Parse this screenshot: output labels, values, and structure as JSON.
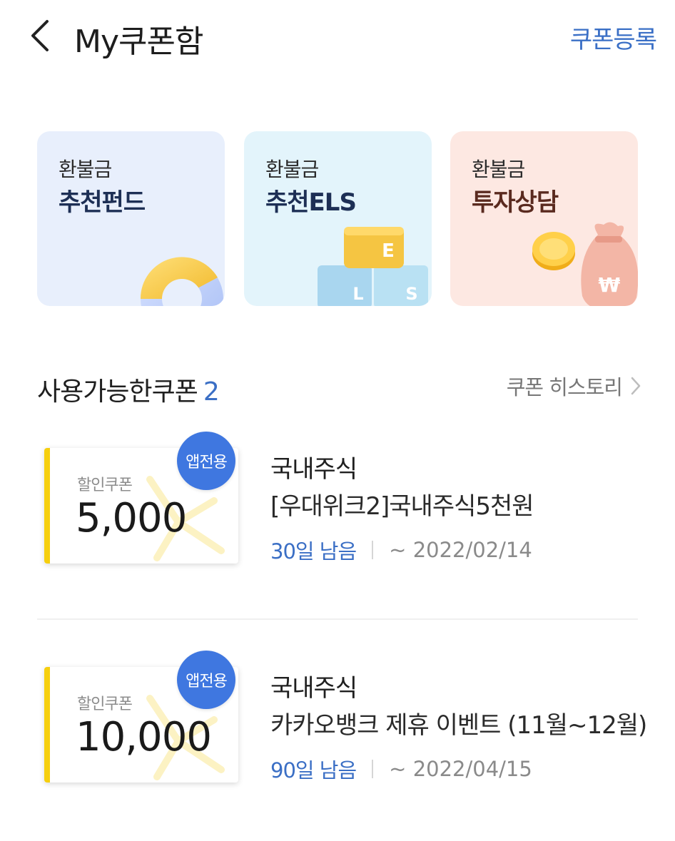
{
  "header": {
    "title": "My쿠폰함",
    "register_label": "쿠폰등록"
  },
  "promo_cards": [
    {
      "small": "환불금",
      "big": "추천펀드"
    },
    {
      "small": "환불금",
      "big": "추천ELS",
      "letters": [
        "E",
        "L",
        "S"
      ]
    },
    {
      "small": "환불금",
      "big": "투자상담",
      "symbol": "₩"
    }
  ],
  "section": {
    "title": "사용가능한쿠폰",
    "count": "2",
    "history_label": "쿠폰 히스토리"
  },
  "coupons": [
    {
      "badge": "앱전용",
      "type_label": "할인쿠폰",
      "amount": "5,000",
      "category": "국내주식",
      "name": "[우대위크2]국내주식5천원",
      "remaining": "30일 남음",
      "expiry": "~ 2022/02/14"
    },
    {
      "badge": "앱전용",
      "type_label": "할인쿠폰",
      "amount": "10,000",
      "category": "국내주식",
      "name": "카카오뱅크 제휴 이벤트 (11월~12월)",
      "remaining": "90일 남음",
      "expiry": "~ 2022/04/15"
    }
  ],
  "colors": {
    "accent_blue": "#3b6fc5",
    "badge_blue": "#3f77e0",
    "ticket_yellow": "#f6cf0e"
  }
}
